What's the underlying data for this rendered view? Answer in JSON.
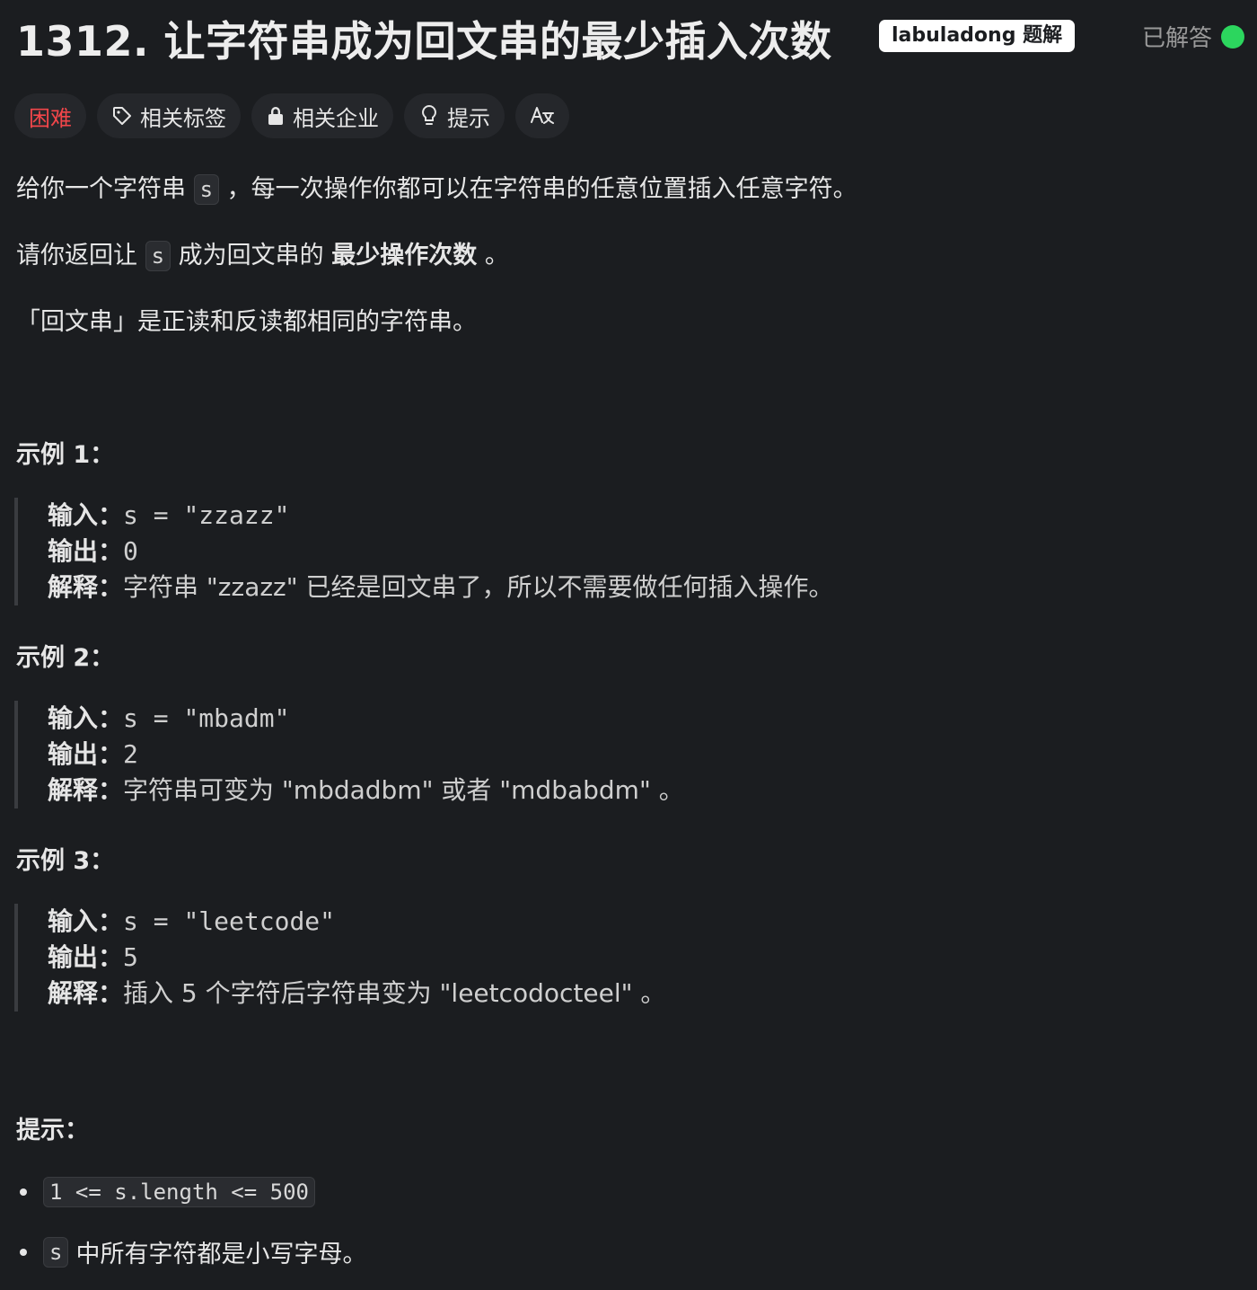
{
  "header": {
    "title": "1312. 让字符串成为回文串的最少插入次数",
    "badge": "labuladong 题解",
    "status": "已解答",
    "status_color": "#2cd65e"
  },
  "tags": {
    "difficulty": "困难",
    "difficulty_color": "#f2464a",
    "related_tags": "相关标签",
    "companies": "相关企业",
    "hints": "提示",
    "translate_icon": "translate-icon"
  },
  "description": {
    "p1_a": "给你一个字符串",
    "p1_code": "s",
    "p1_b": "，每一次操作你都可以在字符串的任意位置插入任意字符。",
    "p2_a": "请你返回让",
    "p2_code": "s",
    "p2_b": "成为回文串的",
    "p2_bold": "最少操作次数",
    "p2_c": "。",
    "p3": "「回文串」是正读和反读都相同的字符串。"
  },
  "examples": [
    {
      "title": "示例 1：",
      "input_label": "输入：",
      "input": "s = \"zzazz\"",
      "output_label": "输出：",
      "output": "0",
      "explain_label": "解释：",
      "explain": "字符串 \"zzazz\" 已经是回文串了，所以不需要做任何插入操作。"
    },
    {
      "title": "示例 2：",
      "input_label": "输入：",
      "input": "s = \"mbadm\"",
      "output_label": "输出：",
      "output": "2",
      "explain_label": "解释：",
      "explain": "字符串可变为 \"mbdadbm\" 或者 \"mdbabdm\" 。"
    },
    {
      "title": "示例 3：",
      "input_label": "输入：",
      "input": "s = \"leetcode\"",
      "output_label": "输出：",
      "output": "5",
      "explain_label": "解释：",
      "explain": "插入 5 个字符后字符串变为 \"leetcodocteel\" 。"
    }
  ],
  "constraints": {
    "title": "提示：",
    "c1_code": "1 <= s.length <= 500",
    "c2_code": "s",
    "c2_text": "中所有字符都是小写字母。"
  }
}
